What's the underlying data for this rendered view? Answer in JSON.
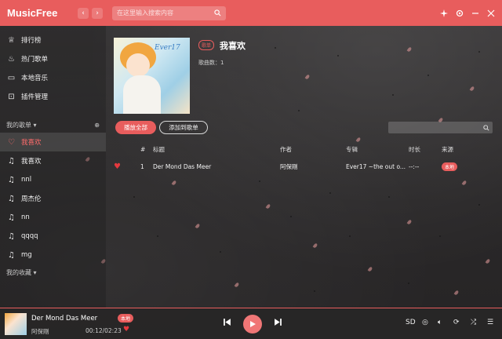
{
  "app": {
    "title": "MusicFree"
  },
  "header": {
    "back_icon": "chevron-left-icon",
    "forward_icon": "chevron-right-icon",
    "search_placeholder": "在这里输入搜索内容",
    "back_label": "‹",
    "forward_label": "›"
  },
  "sidebar": {
    "nav": [
      {
        "label": "排行榜",
        "icon": "trophy-icon"
      },
      {
        "label": "热门歌单",
        "icon": "fire-icon"
      },
      {
        "label": "本地音乐",
        "icon": "folder-icon"
      },
      {
        "label": "插件管理",
        "icon": "plugin-icon"
      }
    ],
    "my_sheets_label": "我的歌单",
    "sheets": [
      {
        "label": "我喜欢",
        "icon": "heart-icon",
        "active": true
      },
      {
        "label": "我喜欢",
        "icon": "music-note-icon"
      },
      {
        "label": "nnl",
        "icon": "music-note-icon"
      },
      {
        "label": "周杰伦",
        "icon": "music-note-icon"
      },
      {
        "label": "nn",
        "icon": "music-note-icon"
      },
      {
        "label": "qqqq",
        "icon": "music-note-icon"
      },
      {
        "label": "mg",
        "icon": "music-note-icon"
      }
    ],
    "my_collections_label": "我的收藏"
  },
  "sheet": {
    "badge": "歌单",
    "title": "我喜欢",
    "count_label": "歌曲数：1",
    "cover_text": "Ever17",
    "play_all": "播放全部",
    "add_to_sheet": "添加到歌单"
  },
  "table": {
    "headers": {
      "index": "#",
      "title": "标题",
      "artist": "作者",
      "album": "专辑",
      "duration": "时长",
      "source": "来源"
    },
    "rows": [
      {
        "index": "1",
        "title": "Der Mond Das Meer",
        "artist": "阿保剛",
        "album": "Ever17 ~the out o...",
        "duration": "--:--",
        "source": "本地"
      }
    ]
  },
  "player": {
    "title": "Der Mond Das Meer",
    "source_badge": "本地",
    "artist": "阿保剛",
    "time": "00:12/02:23",
    "quality": "SD"
  },
  "colors": {
    "accent": "#e85d5d",
    "heart": "#e5393e"
  }
}
